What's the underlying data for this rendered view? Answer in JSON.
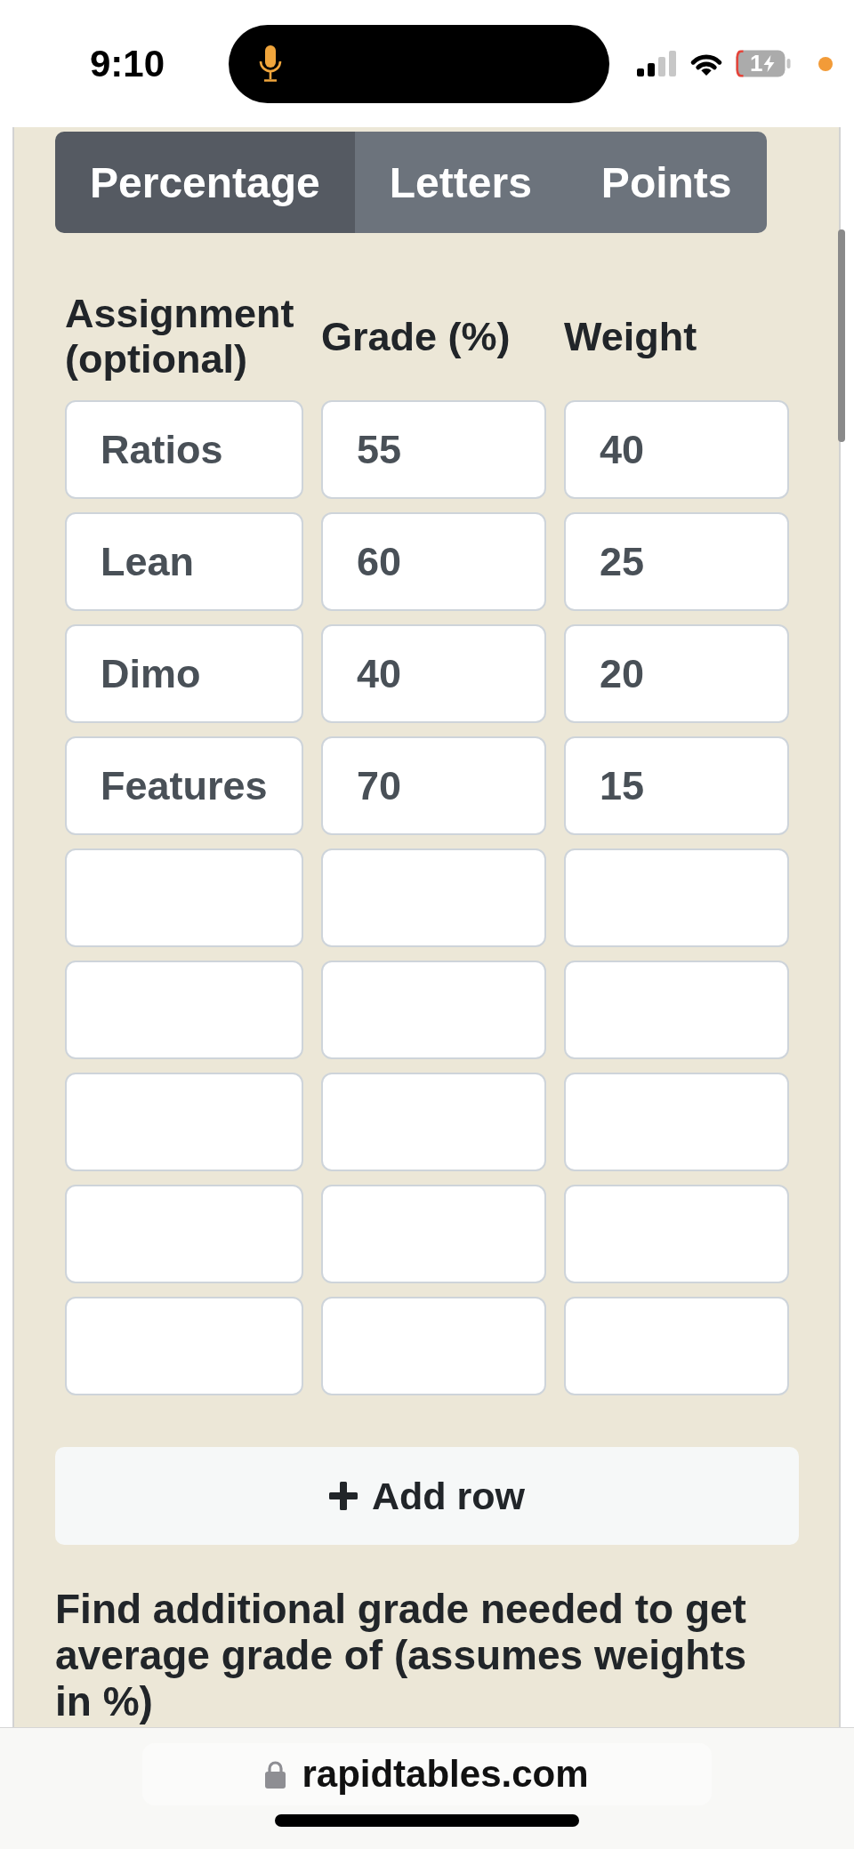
{
  "status_bar": {
    "time": "9:10",
    "battery": "1"
  },
  "tabs": [
    {
      "label": "Percentage",
      "selected": true
    },
    {
      "label": "Letters",
      "selected": false
    },
    {
      "label": "Points",
      "selected": false
    }
  ],
  "table": {
    "columns": [
      "Assignment (optional)",
      "Grade (%)",
      "Weight"
    ],
    "rows": [
      {
        "assignment": "Ratios",
        "grade": "55",
        "weight": "40"
      },
      {
        "assignment": "Lean",
        "grade": "60",
        "weight": "25"
      },
      {
        "assignment": "Dimo",
        "grade": "40",
        "weight": "20"
      },
      {
        "assignment": "Features",
        "grade": "70",
        "weight": "15"
      },
      {},
      {},
      {},
      {},
      {}
    ]
  },
  "add_row_button": {
    "label": "Add row"
  },
  "target_section": {
    "heading": "Find additional grade needed to get average grade of (assumes weights in %)"
  },
  "browser_bar": {
    "url": "rapidtables.com"
  }
}
